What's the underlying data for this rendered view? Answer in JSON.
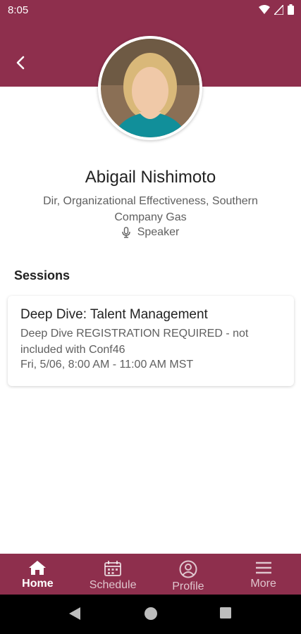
{
  "status_bar": {
    "time": "8:05"
  },
  "profile": {
    "name": "Abigail Nishimoto",
    "role": "Dir, Organizational Effectiveness, Southern Company Gas",
    "tag": "Speaker"
  },
  "sessions": {
    "heading": "Sessions",
    "items": [
      {
        "title": "Deep Dive: Talent Management",
        "description": "Deep Dive REGISTRATION REQUIRED - not included with Conf46",
        "time": "Fri, 5/06, 8:00 AM - 11:00 AM MST"
      }
    ]
  },
  "bottom_nav": {
    "items": [
      {
        "label": "Home",
        "icon": "home-icon",
        "active": true
      },
      {
        "label": "Schedule",
        "icon": "calendar-icon",
        "active": false
      },
      {
        "label": "Profile",
        "icon": "profile-icon",
        "active": false
      },
      {
        "label": "More",
        "icon": "menu-icon",
        "active": false
      }
    ]
  },
  "colors": {
    "brand": "#8e2f4d",
    "text_primary": "#222222",
    "text_secondary": "#5f5f5f"
  }
}
